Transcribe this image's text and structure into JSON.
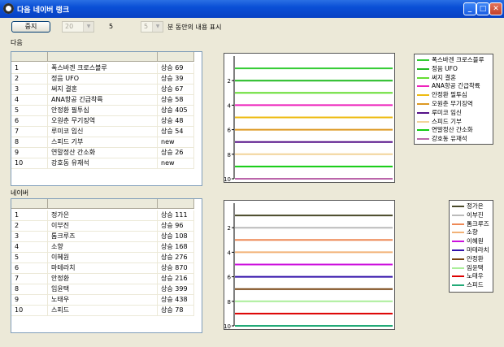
{
  "window": {
    "title": "다음 네이버 랭크"
  },
  "toolbar": {
    "stop_label": "중지",
    "interval_value": "20",
    "count_value": "5",
    "minutes_value": "5",
    "minutes_suffix": "분 동안의 내용 표시"
  },
  "daum": {
    "section_label": "다음",
    "rows": [
      {
        "rank": "1",
        "keyword": "폭스바겐 크로스블루",
        "change": "상승 69"
      },
      {
        "rank": "2",
        "keyword": "정음 UFO",
        "change": "상승 39"
      },
      {
        "rank": "3",
        "keyword": "써지 결혼",
        "change": "상승 67"
      },
      {
        "rank": "4",
        "keyword": "ANA항공 긴급착륙",
        "change": "상승 58"
      },
      {
        "rank": "5",
        "keyword": "안정환 필투심",
        "change": "상승 405"
      },
      {
        "rank": "6",
        "keyword": "오원춘 무기징역",
        "change": "상승 48"
      },
      {
        "rank": "7",
        "keyword": "루미코 임신",
        "change": "상승 54"
      },
      {
        "rank": "8",
        "keyword": "스피드 기부",
        "change": "new"
      },
      {
        "rank": "9",
        "keyword": "연말정산 간소화",
        "change": "상승 26"
      },
      {
        "rank": "10",
        "keyword": "강호동 유재석",
        "change": "new"
      }
    ]
  },
  "naver": {
    "section_label": "네이버",
    "rows": [
      {
        "rank": "1",
        "keyword": "정가은",
        "change": "상승 111"
      },
      {
        "rank": "2",
        "keyword": "이부진",
        "change": "상승 96"
      },
      {
        "rank": "3",
        "keyword": "톰크루즈",
        "change": "상승 108"
      },
      {
        "rank": "4",
        "keyword": "소향",
        "change": "상승 168"
      },
      {
        "rank": "5",
        "keyword": "이혜원",
        "change": "상승 276"
      },
      {
        "rank": "6",
        "keyword": "마테라치",
        "change": "상승 870"
      },
      {
        "rank": "7",
        "keyword": "안정환",
        "change": "상승 216"
      },
      {
        "rank": "8",
        "keyword": "임윤택",
        "change": "상승 399"
      },
      {
        "rank": "9",
        "keyword": "노태우",
        "change": "상승 438"
      },
      {
        "rank": "10",
        "keyword": "스피드",
        "change": "상승 78"
      }
    ]
  },
  "chart_data": [
    {
      "type": "line",
      "ylim": [
        10,
        0
      ],
      "yticks": [
        "2",
        "4",
        "6",
        "8",
        "10"
      ],
      "series": [
        {
          "name": "폭스바겐 크로스블루",
          "color": "#33cc33",
          "rank": 1
        },
        {
          "name": "정음 UFO",
          "color": "#22bb22",
          "rank": 2
        },
        {
          "name": "써지 결혼",
          "color": "#66dd33",
          "rank": 3
        },
        {
          "name": "ANA항공 긴급착륙",
          "color": "#ee22bb",
          "rank": 4
        },
        {
          "name": "안정환 필투심",
          "color": "#eebb11",
          "rank": 5
        },
        {
          "name": "오원춘 무기징역",
          "color": "#dd9922",
          "rank": 6
        },
        {
          "name": "루미코 임신",
          "color": "#551188",
          "rank": 7
        },
        {
          "name": "스피드 기부",
          "color": "#f2d49a",
          "rank": 8
        },
        {
          "name": "연말정산 간소화",
          "color": "#11cc11",
          "rank": 9
        },
        {
          "name": "강호동 유재석",
          "color": "#bb66aa",
          "rank": 10
        }
      ]
    },
    {
      "type": "line",
      "ylim": [
        10,
        0
      ],
      "yticks": [
        "2",
        "4",
        "6",
        "8",
        "10"
      ],
      "series": [
        {
          "name": "정가은",
          "color": "#4a4a2a",
          "rank": 1
        },
        {
          "name": "이부진",
          "color": "#bbbbbb",
          "rank": 2
        },
        {
          "name": "톰크루즈",
          "color": "#ee8855",
          "rank": 3
        },
        {
          "name": "소향",
          "color": "#f2b277",
          "rank": 4
        },
        {
          "name": "이혜원",
          "color": "#cc11dd",
          "rank": 5
        },
        {
          "name": "마테라치",
          "color": "#3311aa",
          "rank": 6
        },
        {
          "name": "안정환",
          "color": "#774411",
          "rank": 7
        },
        {
          "name": "임윤택",
          "color": "#aaee99",
          "rank": 8
        },
        {
          "name": "노태우",
          "color": "#dd0000",
          "rank": 9
        },
        {
          "name": "스피드",
          "color": "#22aa77",
          "rank": 10
        }
      ]
    }
  ]
}
